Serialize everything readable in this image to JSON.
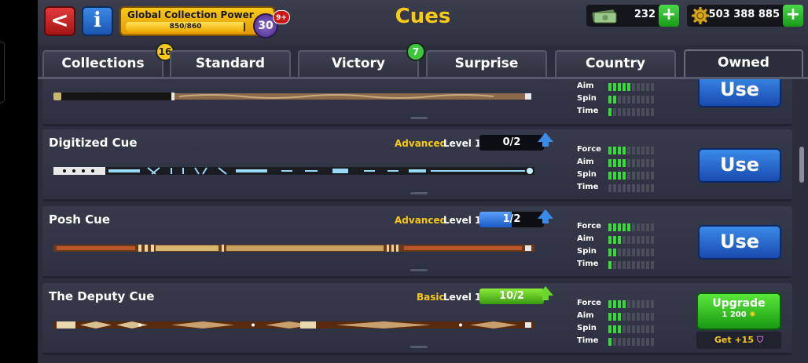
{
  "header": {
    "back_icon": "arrow-left-icon",
    "info_icon": "info-icon",
    "info_label": "i",
    "back_label": "<",
    "collection": {
      "title": "Global Collection Power",
      "progress_text": "850/860",
      "progress": 0.988,
      "level": "30",
      "badge": "9+"
    },
    "title": "Cues",
    "cash": {
      "icon": "cash-icon",
      "value": "232",
      "add_label": "+"
    },
    "coins": {
      "icon": "coin-icon",
      "value": "503 388 885",
      "add_label": "+"
    }
  },
  "tabs": [
    {
      "label": "Collections",
      "badge": "16"
    },
    {
      "label": "Standard",
      "badge": ""
    },
    {
      "label": "Victory",
      "badge": "7"
    },
    {
      "label": "Surprise",
      "badge": ""
    },
    {
      "label": "Country",
      "badge": ""
    },
    {
      "label": "Owned",
      "badge": ""
    }
  ],
  "colors": {
    "accent": "#f8c81a",
    "use_button": "#1a4ab0",
    "upgrade_button": "#1a9a14",
    "stat_on": "#3ad83a"
  },
  "cues": [
    {
      "name": "",
      "tier": "",
      "level": "",
      "progress_text": "",
      "stats": [
        {
          "label": "Aim",
          "value": 5,
          "max": 10
        },
        {
          "label": "Spin",
          "value": 2,
          "max": 10
        },
        {
          "label": "Time",
          "value": 1,
          "max": 10
        }
      ],
      "action": "Use"
    },
    {
      "name": "Digitized Cue",
      "tier": "Advanced",
      "level": "Level 1",
      "progress_text": "0/2",
      "progress": 0,
      "stats": [
        {
          "label": "Force",
          "value": 4,
          "max": 10
        },
        {
          "label": "Aim",
          "value": 4,
          "max": 10
        },
        {
          "label": "Spin",
          "value": 4,
          "max": 10
        },
        {
          "label": "Time",
          "value": 0,
          "max": 10
        }
      ],
      "action": "Use"
    },
    {
      "name": "Posh Cue",
      "tier": "Advanced",
      "level": "Level 1",
      "progress_text": "1/2",
      "progress": 0.5,
      "stats": [
        {
          "label": "Force",
          "value": 5,
          "max": 10
        },
        {
          "label": "Aim",
          "value": 3,
          "max": 10
        },
        {
          "label": "Spin",
          "value": 2,
          "max": 10
        },
        {
          "label": "Time",
          "value": 1,
          "max": 10
        }
      ],
      "action": "Use"
    },
    {
      "name": "The Deputy Cue",
      "tier": "Basic",
      "level": "Level 1",
      "progress_text": "10/2",
      "progress": 1,
      "stats": [
        {
          "label": "Force",
          "value": 4,
          "max": 10
        },
        {
          "label": "Aim",
          "value": 3,
          "max": 10
        },
        {
          "label": "Spin",
          "value": 3,
          "max": 10
        },
        {
          "label": "Time",
          "value": 1,
          "max": 10
        }
      ],
      "action": "Upgrade",
      "upgrade_cost": "1 200",
      "bonus_text": "Get +15"
    }
  ]
}
